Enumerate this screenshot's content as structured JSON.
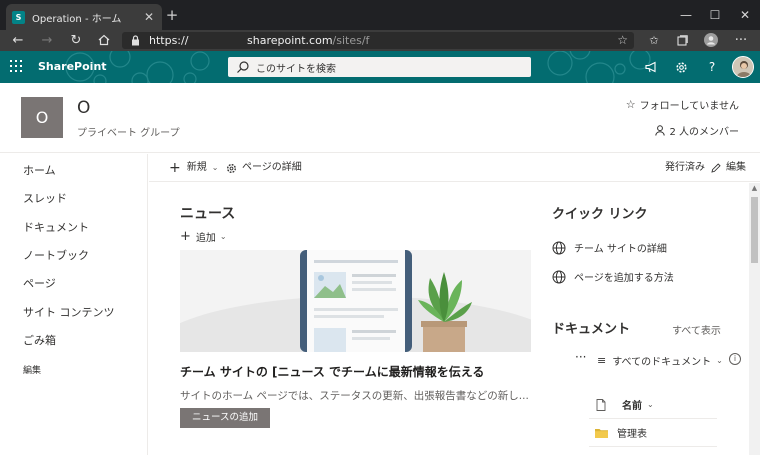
{
  "browser": {
    "tab_title": "Operation - ホーム",
    "tab_favicon_text": "S",
    "tab_close": "✕",
    "new_tab": "+",
    "url_scheme": "https://",
    "url_host": "sharepoint.com",
    "url_path": "/sites/f",
    "window_controls": {
      "minimize": "—",
      "maximize": "☐",
      "close": "✕"
    }
  },
  "suitebar": {
    "brand": "SharePoint",
    "search_placeholder": "このサイトを検索",
    "icons": [
      "megaphone-icon",
      "gear-icon",
      "help-icon"
    ],
    "help_glyph": "?",
    "accent": "#036c70"
  },
  "site": {
    "logo_letter": "O",
    "title": "O",
    "subtitle": "プライベート グループ",
    "follow_label": "フォローしていません",
    "members_label": "2 人のメンバー"
  },
  "leftnav": {
    "items": [
      "ホーム",
      "スレッド",
      "ドキュメント",
      "ノートブック",
      "ページ",
      "サイト コンテンツ",
      "ごみ箱"
    ],
    "edit_label": "編集"
  },
  "commandbar": {
    "new_label": "新規",
    "page_details_label": "ページの詳細",
    "status_label": "発行済み",
    "edit_label": "編集"
  },
  "news": {
    "title": "ニュース",
    "add_label": "追加",
    "headline": "チーム サイトの [ニュース でチームに最新情報を伝える",
    "description": "サイトのホーム ページでは、ステータスの更新、出張報告書などの新し...",
    "button_label": "ニュースの追加"
  },
  "quick_links": {
    "title": "クイック リンク",
    "items": [
      "チーム サイトの詳細",
      "ページを追加する方法"
    ]
  },
  "documents": {
    "title": "ドキュメント",
    "see_all": "すべて表示",
    "more": "···",
    "view_label": "すべてのドキュメント",
    "column_name": "名前",
    "rows": [
      "管理表"
    ]
  }
}
